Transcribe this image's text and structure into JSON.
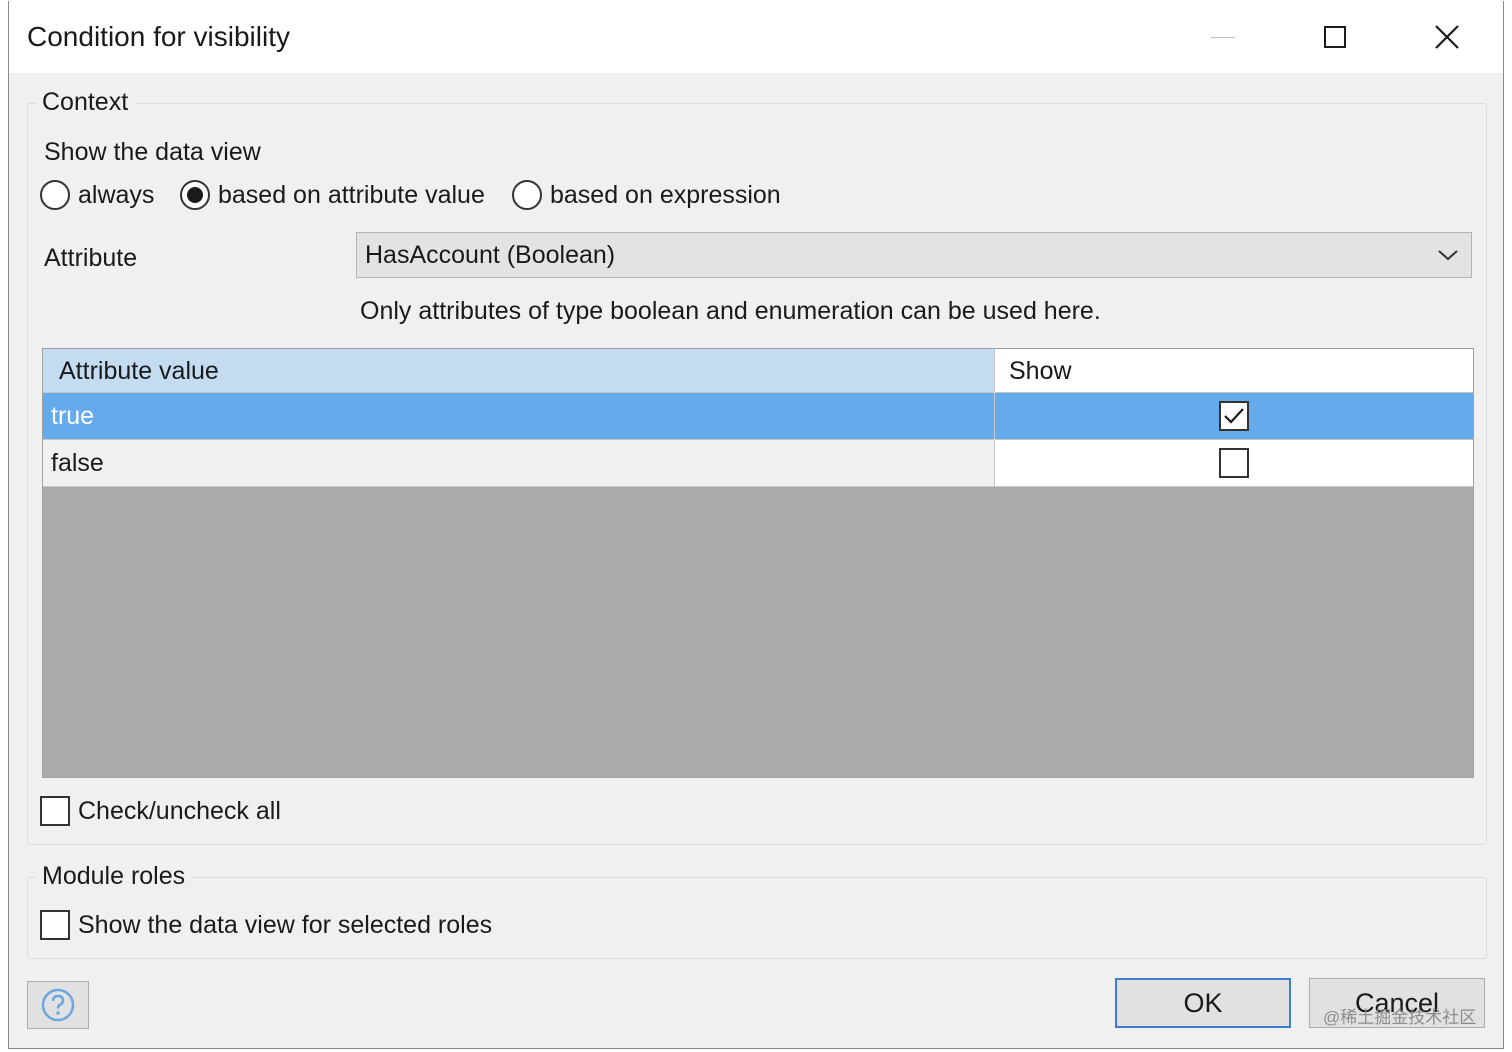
{
  "window": {
    "title": "Condition for visibility"
  },
  "context": {
    "legend": "Context",
    "show_label": "Show the data view",
    "radios": [
      {
        "label": "always",
        "selected": false
      },
      {
        "label": "based on attribute value",
        "selected": true
      },
      {
        "label": "based on expression",
        "selected": false
      }
    ],
    "attribute_label": "Attribute",
    "attribute_value": "HasAccount (Boolean)",
    "hint": "Only attributes of type boolean and enumeration can be used here.",
    "grid": {
      "columns": [
        "Attribute value",
        "Show"
      ],
      "rows": [
        {
          "value": "true",
          "show": true,
          "selected": true
        },
        {
          "value": "false",
          "show": false,
          "selected": false
        }
      ]
    },
    "check_all_label": "Check/uncheck all"
  },
  "roles": {
    "legend": "Module roles",
    "checkbox_label": "Show the data view for selected roles"
  },
  "buttons": {
    "ok": "OK",
    "cancel": "Cancel"
  },
  "watermark": "@稀土掘金技术社区",
  "icons": [
    "minimize-icon",
    "maximize-icon",
    "close-icon",
    "chevron-down-icon",
    "checkmark-icon",
    "help-icon"
  ],
  "colors": {
    "selection": "#64aaec",
    "header_highlight": "#c3dcf2",
    "grid_empty": "#ababab",
    "ok_border": "#3c7fd1",
    "help_icon": "#6aa7e0"
  }
}
